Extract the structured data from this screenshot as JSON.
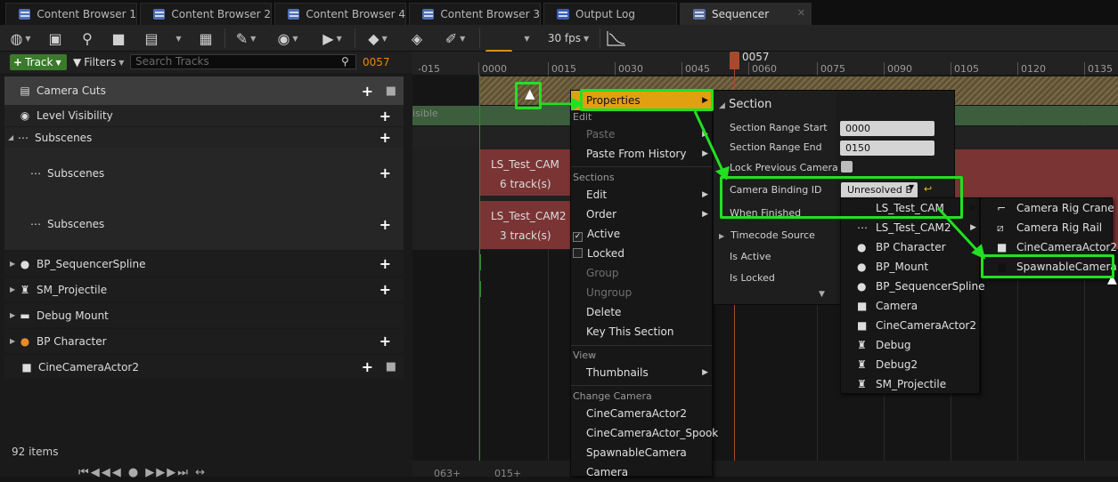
{
  "tabs": [
    {
      "label": "Content Browser 1"
    },
    {
      "label": "Content Browser 2"
    },
    {
      "label": "Content Browser 4"
    },
    {
      "label": "Content Browser 3"
    },
    {
      "label": "Output Log"
    },
    {
      "label": "Sequencer"
    }
  ],
  "toolbar": {
    "fps": "30 fps"
  },
  "filterbar": {
    "track_label": "Track",
    "filters_label": "Filters",
    "search_placeholder": "Search Tracks",
    "current_frame": "0057"
  },
  "tracks": [
    {
      "label": "Camera Cuts"
    },
    {
      "label": "Level Visibility"
    },
    {
      "label": "Subscenes"
    },
    {
      "label": "Subscenes"
    },
    {
      "label": "Subscenes"
    },
    {
      "label": "BP_SequencerSpline"
    },
    {
      "label": "SM_Projectile"
    },
    {
      "label": "Debug Mount"
    },
    {
      "label": "BP Character"
    },
    {
      "label": "CineCameraActor2"
    }
  ],
  "footer": {
    "items_count": "92 items"
  },
  "ruler": {
    "ticks": [
      "-015",
      "0000",
      "0015",
      "0030",
      "0045",
      "0060",
      "0075",
      "0090",
      "0105",
      "0120",
      "0135"
    ],
    "playhead": "0057"
  },
  "timeline": {
    "visible_text": "isible",
    "sections": [
      {
        "name": "LS_Test_CAM",
        "tracks": "6 track(s)"
      },
      {
        "name": "LS_Test_CAM2",
        "tracks": "3 track(s)"
      }
    ],
    "bottom_ticks": [
      "063+",
      "015+"
    ]
  },
  "context_menu": {
    "properties": "Properties",
    "edit_header": "Edit",
    "paste": "Paste",
    "paste_from_history": "Paste From History",
    "sections_header": "Sections",
    "edit": "Edit",
    "order": "Order",
    "active": "Active",
    "locked": "Locked",
    "group": "Group",
    "ungroup": "Ungroup",
    "delete": "Delete",
    "key_this_section": "Key This Section",
    "view_header": "View",
    "thumbnails": "Thumbnails",
    "change_camera_header": "Change Camera",
    "cameras": [
      "CineCameraActor2",
      "CineCameraActor_Spook",
      "SpawnableCamera",
      "Camera"
    ]
  },
  "section_panel": {
    "title": "Section",
    "range_start_label": "Section Range Start",
    "range_start": "0000",
    "range_end_label": "Section Range End",
    "range_end": "0150",
    "lock_prev_label": "Lock Previous Camera",
    "binding_label": "Camera Binding ID",
    "binding_value": "Unresolved B",
    "when_finished_label": "When Finished",
    "timecode_label": "Timecode Source",
    "is_active_label": "Is Active",
    "is_locked_label": "Is Locked"
  },
  "binding_menu": [
    "LS_Test_CAM",
    "LS_Test_CAM2",
    "BP Character",
    "BP_Mount",
    "BP_SequencerSpline",
    "Camera",
    "CineCameraActor2",
    "Debug",
    "Debug2",
    "SM_Projectile"
  ],
  "camera_submenu": [
    "Camera Rig Crane",
    "Camera Rig Rail",
    "CineCameraActor2",
    "SpawnableCamera"
  ],
  "colors": {
    "accent": "#e0a010",
    "highlight": "#22e022",
    "add_track": "#3a7a2a"
  }
}
